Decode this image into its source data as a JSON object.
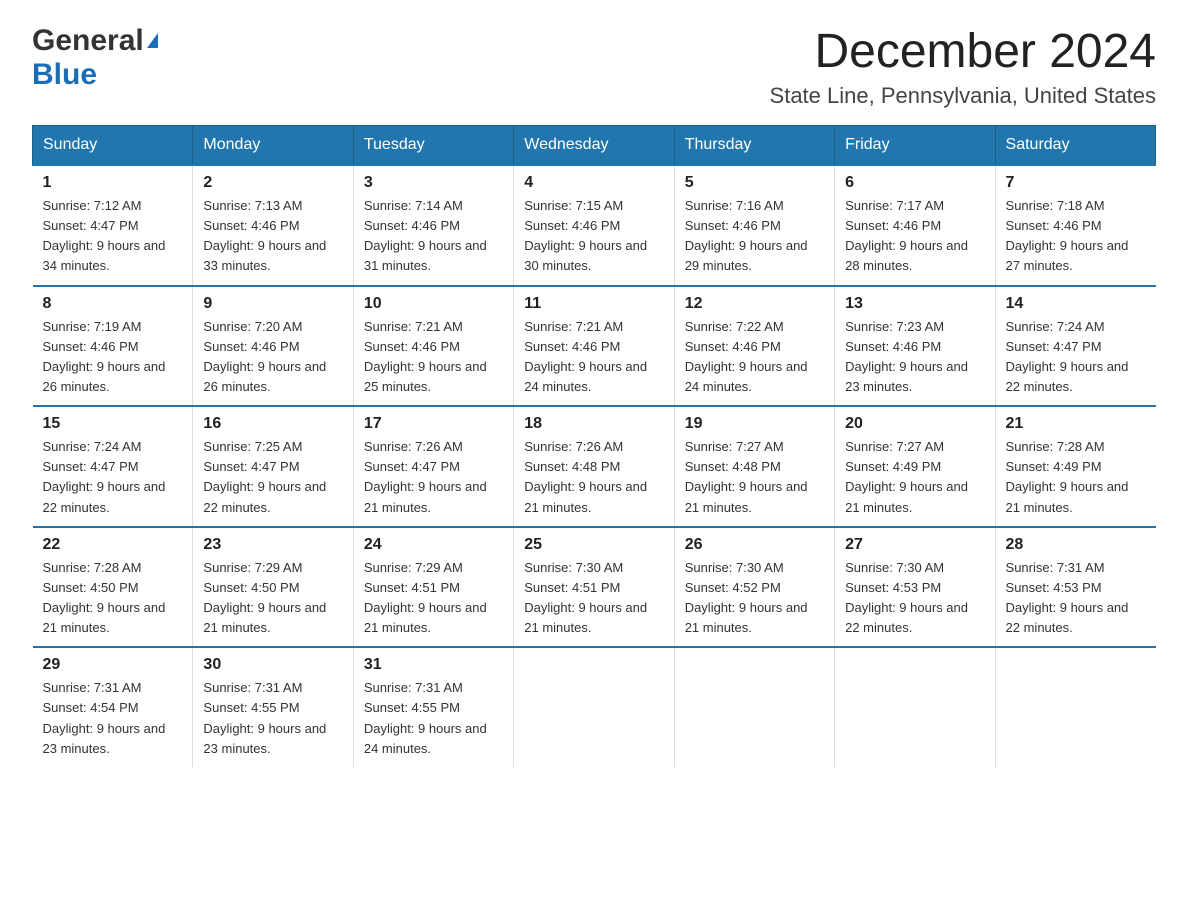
{
  "header": {
    "logo_general": "General",
    "logo_blue": "Blue",
    "month": "December 2024",
    "location": "State Line, Pennsylvania, United States"
  },
  "days_of_week": [
    "Sunday",
    "Monday",
    "Tuesday",
    "Wednesday",
    "Thursday",
    "Friday",
    "Saturday"
  ],
  "weeks": [
    [
      {
        "day": "1",
        "sunrise": "Sunrise: 7:12 AM",
        "sunset": "Sunset: 4:47 PM",
        "daylight": "Daylight: 9 hours and 34 minutes."
      },
      {
        "day": "2",
        "sunrise": "Sunrise: 7:13 AM",
        "sunset": "Sunset: 4:46 PM",
        "daylight": "Daylight: 9 hours and 33 minutes."
      },
      {
        "day": "3",
        "sunrise": "Sunrise: 7:14 AM",
        "sunset": "Sunset: 4:46 PM",
        "daylight": "Daylight: 9 hours and 31 minutes."
      },
      {
        "day": "4",
        "sunrise": "Sunrise: 7:15 AM",
        "sunset": "Sunset: 4:46 PM",
        "daylight": "Daylight: 9 hours and 30 minutes."
      },
      {
        "day": "5",
        "sunrise": "Sunrise: 7:16 AM",
        "sunset": "Sunset: 4:46 PM",
        "daylight": "Daylight: 9 hours and 29 minutes."
      },
      {
        "day": "6",
        "sunrise": "Sunrise: 7:17 AM",
        "sunset": "Sunset: 4:46 PM",
        "daylight": "Daylight: 9 hours and 28 minutes."
      },
      {
        "day": "7",
        "sunrise": "Sunrise: 7:18 AM",
        "sunset": "Sunset: 4:46 PM",
        "daylight": "Daylight: 9 hours and 27 minutes."
      }
    ],
    [
      {
        "day": "8",
        "sunrise": "Sunrise: 7:19 AM",
        "sunset": "Sunset: 4:46 PM",
        "daylight": "Daylight: 9 hours and 26 minutes."
      },
      {
        "day": "9",
        "sunrise": "Sunrise: 7:20 AM",
        "sunset": "Sunset: 4:46 PM",
        "daylight": "Daylight: 9 hours and 26 minutes."
      },
      {
        "day": "10",
        "sunrise": "Sunrise: 7:21 AM",
        "sunset": "Sunset: 4:46 PM",
        "daylight": "Daylight: 9 hours and 25 minutes."
      },
      {
        "day": "11",
        "sunrise": "Sunrise: 7:21 AM",
        "sunset": "Sunset: 4:46 PM",
        "daylight": "Daylight: 9 hours and 24 minutes."
      },
      {
        "day": "12",
        "sunrise": "Sunrise: 7:22 AM",
        "sunset": "Sunset: 4:46 PM",
        "daylight": "Daylight: 9 hours and 24 minutes."
      },
      {
        "day": "13",
        "sunrise": "Sunrise: 7:23 AM",
        "sunset": "Sunset: 4:46 PM",
        "daylight": "Daylight: 9 hours and 23 minutes."
      },
      {
        "day": "14",
        "sunrise": "Sunrise: 7:24 AM",
        "sunset": "Sunset: 4:47 PM",
        "daylight": "Daylight: 9 hours and 22 minutes."
      }
    ],
    [
      {
        "day": "15",
        "sunrise": "Sunrise: 7:24 AM",
        "sunset": "Sunset: 4:47 PM",
        "daylight": "Daylight: 9 hours and 22 minutes."
      },
      {
        "day": "16",
        "sunrise": "Sunrise: 7:25 AM",
        "sunset": "Sunset: 4:47 PM",
        "daylight": "Daylight: 9 hours and 22 minutes."
      },
      {
        "day": "17",
        "sunrise": "Sunrise: 7:26 AM",
        "sunset": "Sunset: 4:47 PM",
        "daylight": "Daylight: 9 hours and 21 minutes."
      },
      {
        "day": "18",
        "sunrise": "Sunrise: 7:26 AM",
        "sunset": "Sunset: 4:48 PM",
        "daylight": "Daylight: 9 hours and 21 minutes."
      },
      {
        "day": "19",
        "sunrise": "Sunrise: 7:27 AM",
        "sunset": "Sunset: 4:48 PM",
        "daylight": "Daylight: 9 hours and 21 minutes."
      },
      {
        "day": "20",
        "sunrise": "Sunrise: 7:27 AM",
        "sunset": "Sunset: 4:49 PM",
        "daylight": "Daylight: 9 hours and 21 minutes."
      },
      {
        "day": "21",
        "sunrise": "Sunrise: 7:28 AM",
        "sunset": "Sunset: 4:49 PM",
        "daylight": "Daylight: 9 hours and 21 minutes."
      }
    ],
    [
      {
        "day": "22",
        "sunrise": "Sunrise: 7:28 AM",
        "sunset": "Sunset: 4:50 PM",
        "daylight": "Daylight: 9 hours and 21 minutes."
      },
      {
        "day": "23",
        "sunrise": "Sunrise: 7:29 AM",
        "sunset": "Sunset: 4:50 PM",
        "daylight": "Daylight: 9 hours and 21 minutes."
      },
      {
        "day": "24",
        "sunrise": "Sunrise: 7:29 AM",
        "sunset": "Sunset: 4:51 PM",
        "daylight": "Daylight: 9 hours and 21 minutes."
      },
      {
        "day": "25",
        "sunrise": "Sunrise: 7:30 AM",
        "sunset": "Sunset: 4:51 PM",
        "daylight": "Daylight: 9 hours and 21 minutes."
      },
      {
        "day": "26",
        "sunrise": "Sunrise: 7:30 AM",
        "sunset": "Sunset: 4:52 PM",
        "daylight": "Daylight: 9 hours and 21 minutes."
      },
      {
        "day": "27",
        "sunrise": "Sunrise: 7:30 AM",
        "sunset": "Sunset: 4:53 PM",
        "daylight": "Daylight: 9 hours and 22 minutes."
      },
      {
        "day": "28",
        "sunrise": "Sunrise: 7:31 AM",
        "sunset": "Sunset: 4:53 PM",
        "daylight": "Daylight: 9 hours and 22 minutes."
      }
    ],
    [
      {
        "day": "29",
        "sunrise": "Sunrise: 7:31 AM",
        "sunset": "Sunset: 4:54 PM",
        "daylight": "Daylight: 9 hours and 23 minutes."
      },
      {
        "day": "30",
        "sunrise": "Sunrise: 7:31 AM",
        "sunset": "Sunset: 4:55 PM",
        "daylight": "Daylight: 9 hours and 23 minutes."
      },
      {
        "day": "31",
        "sunrise": "Sunrise: 7:31 AM",
        "sunset": "Sunset: 4:55 PM",
        "daylight": "Daylight: 9 hours and 24 minutes."
      },
      {
        "day": "",
        "sunrise": "",
        "sunset": "",
        "daylight": ""
      },
      {
        "day": "",
        "sunrise": "",
        "sunset": "",
        "daylight": ""
      },
      {
        "day": "",
        "sunrise": "",
        "sunset": "",
        "daylight": ""
      },
      {
        "day": "",
        "sunrise": "",
        "sunset": "",
        "daylight": ""
      }
    ]
  ]
}
